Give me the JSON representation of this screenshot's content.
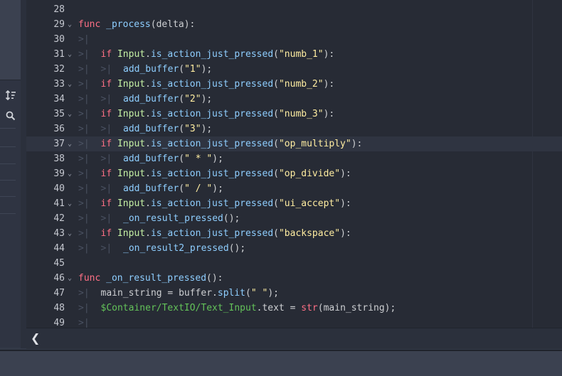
{
  "left_panel": {
    "tool_icons": [
      "sort-icon",
      "search-icon"
    ],
    "list_separator_count": 6
  },
  "editor": {
    "current_line": 37,
    "lines": [
      {
        "n": "28",
        "fold": false,
        "tabs": 0,
        "tokens": []
      },
      {
        "n": "29",
        "fold": true,
        "tabs": 0,
        "tokens": [
          [
            "kw",
            "func"
          ],
          [
            "plain",
            " "
          ],
          [
            "fn",
            "_process"
          ],
          [
            "plain",
            "(delta):"
          ]
        ]
      },
      {
        "n": "30",
        "fold": false,
        "tabs": 1,
        "tokens": []
      },
      {
        "n": "31",
        "fold": true,
        "tabs": 1,
        "tokens": [
          [
            "kw",
            "if"
          ],
          [
            "plain",
            " "
          ],
          [
            "cls",
            "Input"
          ],
          [
            "plain",
            "."
          ],
          [
            "fn",
            "is_action_just_pressed"
          ],
          [
            "plain",
            "("
          ],
          [
            "str",
            "\"numb_1\""
          ],
          [
            "plain",
            "):"
          ]
        ]
      },
      {
        "n": "32",
        "fold": false,
        "tabs": 2,
        "tokens": [
          [
            "fn",
            "add_buffer"
          ],
          [
            "plain",
            "("
          ],
          [
            "str",
            "\"1\""
          ],
          [
            "plain",
            ");"
          ]
        ]
      },
      {
        "n": "33",
        "fold": true,
        "tabs": 1,
        "tokens": [
          [
            "kw",
            "if"
          ],
          [
            "plain",
            " "
          ],
          [
            "cls",
            "Input"
          ],
          [
            "plain",
            "."
          ],
          [
            "fn",
            "is_action_just_pressed"
          ],
          [
            "plain",
            "("
          ],
          [
            "str",
            "\"numb_2\""
          ],
          [
            "plain",
            "):"
          ]
        ]
      },
      {
        "n": "34",
        "fold": false,
        "tabs": 2,
        "tokens": [
          [
            "fn",
            "add_buffer"
          ],
          [
            "plain",
            "("
          ],
          [
            "str",
            "\"2\""
          ],
          [
            "plain",
            ");"
          ]
        ]
      },
      {
        "n": "35",
        "fold": true,
        "tabs": 1,
        "tokens": [
          [
            "kw",
            "if"
          ],
          [
            "plain",
            " "
          ],
          [
            "cls",
            "Input"
          ],
          [
            "plain",
            "."
          ],
          [
            "fn",
            "is_action_just_pressed"
          ],
          [
            "plain",
            "("
          ],
          [
            "str",
            "\"numb_3\""
          ],
          [
            "plain",
            "):"
          ]
        ]
      },
      {
        "n": "36",
        "fold": false,
        "tabs": 2,
        "tokens": [
          [
            "fn",
            "add_buffer"
          ],
          [
            "plain",
            "("
          ],
          [
            "str",
            "\"3\""
          ],
          [
            "plain",
            ");"
          ]
        ]
      },
      {
        "n": "37",
        "fold": true,
        "tabs": 1,
        "tokens": [
          [
            "kw",
            "if"
          ],
          [
            "plain",
            " "
          ],
          [
            "cls",
            "Input"
          ],
          [
            "plain",
            "."
          ],
          [
            "fn",
            "is_action_just_pressed"
          ],
          [
            "plain",
            "("
          ],
          [
            "str",
            "\"op_multiply\""
          ],
          [
            "plain",
            "):"
          ]
        ]
      },
      {
        "n": "38",
        "fold": false,
        "tabs": 2,
        "tokens": [
          [
            "fn",
            "add_buffer"
          ],
          [
            "plain",
            "("
          ],
          [
            "str",
            "\" * \""
          ],
          [
            "plain",
            ");"
          ]
        ]
      },
      {
        "n": "39",
        "fold": true,
        "tabs": 1,
        "tokens": [
          [
            "kw",
            "if"
          ],
          [
            "plain",
            " "
          ],
          [
            "cls",
            "Input"
          ],
          [
            "plain",
            "."
          ],
          [
            "fn",
            "is_action_just_pressed"
          ],
          [
            "plain",
            "("
          ],
          [
            "str",
            "\"op_divide\""
          ],
          [
            "plain",
            "):"
          ]
        ]
      },
      {
        "n": "40",
        "fold": false,
        "tabs": 2,
        "tokens": [
          [
            "fn",
            "add_buffer"
          ],
          [
            "plain",
            "("
          ],
          [
            "str",
            "\" / \""
          ],
          [
            "plain",
            ");"
          ]
        ]
      },
      {
        "n": "41",
        "fold": true,
        "tabs": 1,
        "tokens": [
          [
            "kw",
            "if"
          ],
          [
            "plain",
            " "
          ],
          [
            "cls",
            "Input"
          ],
          [
            "plain",
            "."
          ],
          [
            "fn",
            "is_action_just_pressed"
          ],
          [
            "plain",
            "("
          ],
          [
            "str",
            "\"ui_accept\""
          ],
          [
            "plain",
            "):"
          ]
        ]
      },
      {
        "n": "42",
        "fold": false,
        "tabs": 2,
        "tokens": [
          [
            "fn",
            "_on_result_pressed"
          ],
          [
            "plain",
            "();"
          ]
        ]
      },
      {
        "n": "43",
        "fold": true,
        "tabs": 1,
        "tokens": [
          [
            "kw",
            "if"
          ],
          [
            "plain",
            " "
          ],
          [
            "cls",
            "Input"
          ],
          [
            "plain",
            "."
          ],
          [
            "fn",
            "is_action_just_pressed"
          ],
          [
            "plain",
            "("
          ],
          [
            "str",
            "\"backspace\""
          ],
          [
            "plain",
            "):"
          ]
        ]
      },
      {
        "n": "44",
        "fold": false,
        "tabs": 2,
        "tokens": [
          [
            "fn",
            "_on_result2_pressed"
          ],
          [
            "plain",
            "();"
          ]
        ]
      },
      {
        "n": "45",
        "fold": false,
        "tabs": 0,
        "tokens": []
      },
      {
        "n": "46",
        "fold": true,
        "tabs": 0,
        "tokens": [
          [
            "kw",
            "func"
          ],
          [
            "plain",
            " "
          ],
          [
            "fn",
            "_on_result_pressed"
          ],
          [
            "plain",
            "():"
          ]
        ]
      },
      {
        "n": "47",
        "fold": false,
        "tabs": 1,
        "tokens": [
          [
            "plain",
            "main_string = buffer."
          ],
          [
            "fn",
            "split"
          ],
          [
            "plain",
            "("
          ],
          [
            "str",
            "\" \""
          ],
          [
            "plain",
            ");"
          ]
        ]
      },
      {
        "n": "48",
        "fold": false,
        "tabs": 1,
        "tokens": [
          [
            "node",
            "$Container/TextIO/Text_Input"
          ],
          [
            "plain",
            ".text = "
          ],
          [
            "kw",
            "str"
          ],
          [
            "plain",
            "(main_string);"
          ]
        ]
      },
      {
        "n": "49",
        "fold": false,
        "tabs": 1,
        "tokens": []
      }
    ]
  },
  "statusbar": {
    "toggle_label": "❮"
  },
  "colors": {
    "keyword": "#ff7085",
    "function": "#8eceff",
    "string": "#ffeda1",
    "class": "#c4f0a4",
    "node_path": "#63c259",
    "text": "#cdcfd2"
  }
}
